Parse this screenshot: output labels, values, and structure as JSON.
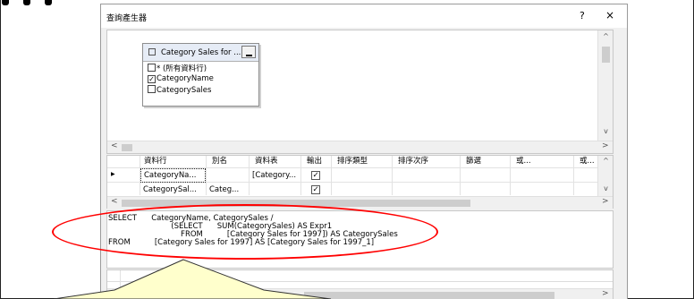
{
  "dialog": {
    "title": "查詢產生器",
    "help_label": "?",
    "close_label": "×"
  },
  "diagram": {
    "table_box": {
      "title": "Category Sales for ...",
      "columns": [
        {
          "label": "* (所有資料行)",
          "checked": false
        },
        {
          "label": "CategoryName",
          "checked": true
        },
        {
          "label": "CategorySales",
          "checked": false
        }
      ]
    }
  },
  "grid": {
    "headers": [
      "資料行",
      "別名",
      "資料表",
      "輸出",
      "排序類型",
      "排序次序",
      "篩選",
      "或...",
      "或..."
    ],
    "rows": [
      {
        "column": "CategoryNa...",
        "alias": "",
        "table": "[Category...",
        "output": true,
        "current": true
      },
      {
        "column": "CategorySal...",
        "alias": "Categ...",
        "table": "",
        "output": true,
        "current": false
      }
    ]
  },
  "sql": {
    "lines": [
      "SELECT      CategoryName, CategorySales /",
      "                          (SELECT      SUM(CategorySales) AS Expr1",
      "                              FROM          [Category Sales for 1997]) AS CategorySales",
      "FROM          [Category Sales for 1997] AS [Category Sales for 1997_1]"
    ]
  },
  "glyphs": {
    "scroll_up": "^",
    "scroll_down": "v",
    "scroll_left": "<",
    "scroll_right": ">",
    "row_pointer": "▶",
    "check": "✓"
  },
  "colors": {
    "annotation_ellipse": "#ff0000",
    "callout_fill": "#ffffcc",
    "dialog_bg": "#f0f0f0"
  }
}
